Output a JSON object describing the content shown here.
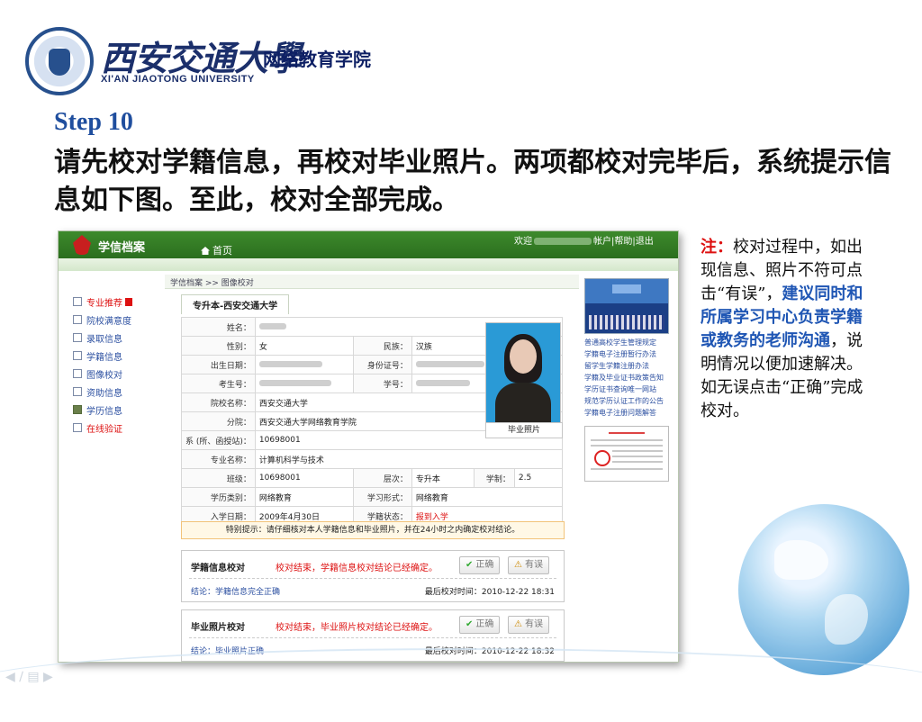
{
  "slide": {
    "logo_cn": "西安交通大學",
    "logo_sub": "网络教育学院",
    "logo_en": "XI'AN JIAOTONG UNIVERSITY",
    "step_title": "Step 10",
    "step_desc": "请先校对学籍信息，再校对毕业照片。两项都校对完毕后，系统提示信息如下图。至此，校对全部完成。"
  },
  "note": {
    "prefix": "注：",
    "part1": "校对过程中，如出现信息、照片不符可点击“有误”，",
    "part2": "建议同时和所属学习中心负责学籍或教务的老师沟通",
    "part3": "，说明情况以便加速解决。如无误点击“正确”完成校对。"
  },
  "screenshot": {
    "app_title": "学信档案",
    "welcome": "欢迎",
    "top_links": "帐户|帮助|退出",
    "home_tab": "首页",
    "sidebar": [
      {
        "label": "专业推荐",
        "red": true,
        "badge": true
      },
      {
        "label": "院校满意度"
      },
      {
        "label": "录取信息"
      },
      {
        "label": "学籍信息"
      },
      {
        "label": "图像校对"
      },
      {
        "label": "资助信息"
      },
      {
        "label": "学历信息",
        "dark": true
      },
      {
        "label": "在线验证",
        "red": true
      }
    ],
    "breadcrumb": "学信档案 >> 图像校对",
    "tab_label": "专升本-西安交通大学",
    "rows": {
      "name_label": "姓名：",
      "gender_label": "性别：",
      "gender": "女",
      "ethnic_label": "民族：",
      "ethnic": "汉族",
      "birth_label": "出生日期：",
      "id_label": "身份证号：",
      "exam_label": "考生号：",
      "student_no_label": "学号：",
      "school_label": "院校名称：",
      "school": "西安交通大学",
      "branch_label": "分院：",
      "branch": "西安交通大学网络教育学院",
      "dept_label": "系 (所、函授站)：",
      "dept": "10698001",
      "major_label": "专业名称：",
      "major": "计算机科学与技术",
      "class_label": "班级：",
      "class": "10698001",
      "level_label": "层次：",
      "level": "专升本",
      "duration_label": "学制：",
      "duration": "2.5",
      "type_label": "学历类别：",
      "type": "网络教育",
      "form_label": "学习形式：",
      "form": "网络教育",
      "enroll_label": "入学日期：",
      "enroll": "2009年4月30日",
      "status_label": "学籍状态：",
      "status": "报到入学"
    },
    "photo_caption": "毕业照片",
    "notice": "特别提示：请仔细核对本人学籍信息和毕业照片，并在24小时之内确定校对结论。",
    "cards": [
      {
        "title": "学籍信息校对",
        "result": "校对结束，学籍信息校对结论已经确定。",
        "correct": "正确",
        "wrong": "有误",
        "conclusion": "结论：学籍信息完全正确",
        "time": "最后校对时间：2010-12-22  18:31"
      },
      {
        "title": "毕业照片校对",
        "result": "校对结束，毕业照片校对结论已经确定。",
        "correct": "正确",
        "wrong": "有误",
        "conclusion": "结论：毕业照片正确",
        "time": "最后校对时间：2010-12-22  18:32"
      }
    ],
    "right_links": [
      "普通高校学生管理规定",
      "学籍电子注册暂行办法",
      "留学生学籍注册办法",
      "学籍及毕业证书政策告知",
      "学历证书查询唯一网站",
      "规范学历认证工作的公告",
      "学籍电子注册问题解答"
    ]
  },
  "icons": {
    "flame": "flame-icon",
    "home": "home-icon",
    "tick": "check-icon",
    "warn": "warning-icon"
  }
}
